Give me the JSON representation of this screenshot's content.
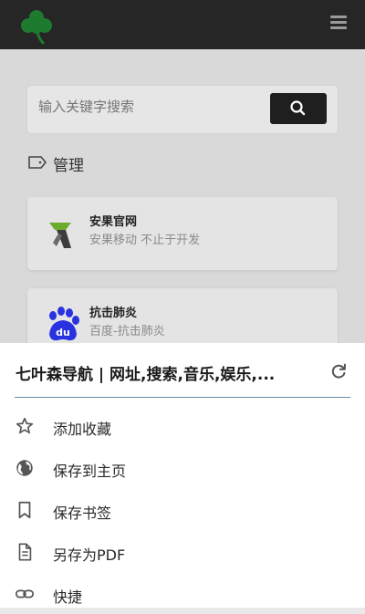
{
  "search": {
    "placeholder": "输入关键字搜索"
  },
  "section": {
    "title": "管理"
  },
  "cards": [
    {
      "title": "安果官网",
      "desc": "安果移动 不止于开发"
    },
    {
      "title": "抗击肺炎",
      "desc": "百度-抗击肺炎"
    }
  ],
  "sheet": {
    "title": "七叶森导航 | 网址,搜索,音乐,娱乐,...",
    "items": [
      {
        "label": "添加收藏",
        "icon": "star-outline-icon"
      },
      {
        "label": "保存到主页",
        "icon": "globe-icon"
      },
      {
        "label": "保存书签",
        "icon": "bookmark-icon"
      },
      {
        "label": "另存为PDF",
        "icon": "document-icon"
      },
      {
        "label": "快捷",
        "icon": "link-icon"
      }
    ]
  },
  "colors": {
    "topbar": "#262626",
    "search_button": "#1f1f1f",
    "divider": "#6b8fa3",
    "logo": "#1e7a2e"
  }
}
